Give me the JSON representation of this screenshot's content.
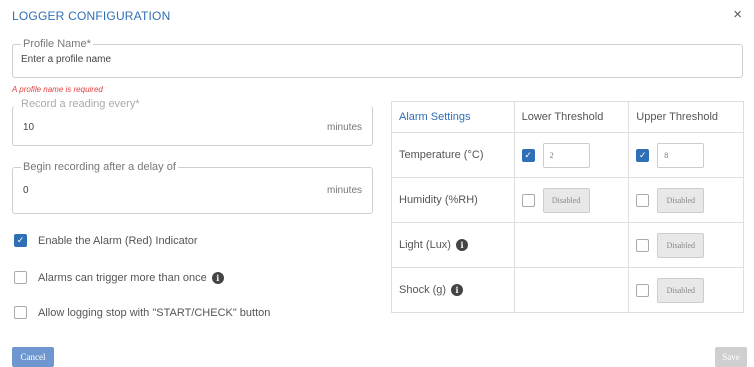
{
  "dialog": {
    "title": "LOGGER CONFIGURATION",
    "close_icon": "×"
  },
  "profile": {
    "label": "Profile Name*",
    "placeholder": "Enter a profile name",
    "error": "A profile name is required"
  },
  "record": {
    "label": "Record a reading every*",
    "value": "10",
    "unit": "minutes"
  },
  "delay": {
    "label": "Begin recording after a delay of",
    "value": "0",
    "unit": "minutes"
  },
  "options": [
    {
      "label": "Enable the Alarm (Red) Indicator",
      "checked": true
    },
    {
      "label": "Alarms can trigger more than once",
      "checked": false
    },
    {
      "label": "Allow logging stop with \"START/CHECK\" button",
      "checked": false
    }
  ],
  "alarm_table": {
    "headers": [
      "Alarm Settings",
      "Lower Threshold",
      "Upper Threshold"
    ],
    "rows": [
      {
        "label": "Temperature (°C)",
        "lower_checked": true,
        "lower_value": "2",
        "upper_checked": true,
        "upper_value": "8"
      },
      {
        "label": "Humidity (%RH)",
        "lower_checked": false,
        "lower_value": "Disabled",
        "upper_checked": false,
        "upper_value": "Disabled"
      },
      {
        "label": "Light (Lux)",
        "upper_checked": false,
        "upper_value": "Disabled"
      },
      {
        "label": "Shock (g)",
        "upper_checked": false,
        "upper_value": "Disabled"
      }
    ]
  },
  "footer": {
    "cancel_label": "Cancel",
    "save_label": "Save"
  },
  "colors": {
    "accent": "#2f6fb5",
    "error": "#e04040"
  },
  "icons": {
    "check": "✓",
    "info": "i"
  }
}
